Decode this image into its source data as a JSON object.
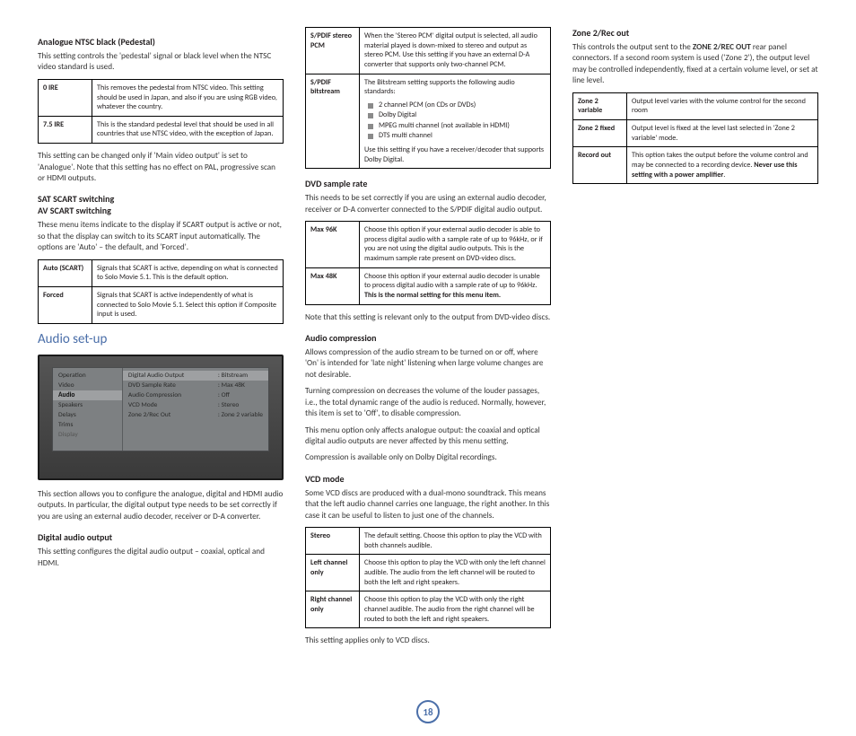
{
  "col1": {
    "h1": "Analogue NTSC black (Pedestal)",
    "p1": "This setting controls the 'pedestal' signal or black level when the NTSC video standard is used.",
    "t1r1l": "0 IRE",
    "t1r1v": "This removes the pedestal from NTSC video. This setting should be used in Japan, and also if you are using RGB video, whatever the country.",
    "t1r2l": "7.5 IRE",
    "t1r2v": "This is the standard pedestal level that should be used in all countries that use NTSC video, with the exception of Japan.",
    "p2": "This setting can be changed only if 'Main video output' is set to 'Analogue'. Note that this setting has no effect on PAL, progressive scan or HDMI outputs.",
    "h2": "SAT SCART switching\nAV SCART switching",
    "p3": "These menu items indicate to the display if SCART output is active or not, so that the display can switch to its SCART input automatically. The options are 'Auto' – the default, and 'Forced'.",
    "t2r1l": "Auto (SCART)",
    "t2r1v": "Signals that SCART is active, depending on what is connected to Solo Movie 5.1. This is the default option.",
    "t2r2l": "Forced",
    "t2r2v": "Signals that SCART is active independently of what is connected to Solo Movie 5.1. Select this option if Composite input is used."
  },
  "col2": {
    "title": "Audio set-up",
    "menu": {
      "left": [
        "Operation",
        "Video",
        "Audio",
        "Speakers",
        "Delays",
        "Trims",
        "Display"
      ],
      "right": [
        [
          "Digital Audio Output",
          ": Bitstream"
        ],
        [
          "DVD Sample Rate",
          ": Max 48K"
        ],
        [
          "Audio Compression",
          ": Off"
        ],
        [
          "VCD Mode",
          ": Stereo"
        ],
        [
          "Zone 2/Rec Out",
          ": Zone 2 variable"
        ]
      ]
    },
    "p1": "This section allows you to configure the analogue, digital and HDMI audio outputs. In particular, the digital output type needs to be set correctly if you are using an external audio decoder, receiver or D-A converter.",
    "h1": "Digital audio output",
    "p2": "This setting configures the digital audio output – coaxial, optical and HDMI.",
    "t1r1l": "S/PDIF stereo PCM",
    "t1r1v": "When the 'Stereo PCM' digital output is selected, all audio material played is down-mixed to stereo and output as stereo PCM. Use this setting if you have an external D-A converter that supports only two-channel PCM.",
    "t1r2l": "S/PDIF bitstream",
    "t1r2v_intro": "The Bitstream setting supports the following audio standards:",
    "t1r2_bullets": [
      "2 channel PCM (on CDs or DVDs)",
      "Dolby Digital",
      "MPEG multi channel (not available in HDMI)",
      "DTS multi channel"
    ],
    "t1r2v_out": "Use this setting if you have a receiver/decoder that supports Dolby Digital.",
    "h2": "DVD sample rate",
    "p3": "This needs to be set correctly if you are using an external audio decoder, receiver or D-A converter connected to the S/PDIF digital audio output.",
    "t2r1l": "Max 96K",
    "t2r1v": "Choose this option if your external audio decoder is able to process digital audio with a sample rate of up to 96kHz, or if you are not using the digital audio outputs. This is the maximum sample rate present on DVD-video discs.",
    "t2r2l": "Max 48K",
    "t2r2v_a": "Choose this option if your external audio decoder is unable to process digital audio with a sample rate of up to 96kHz. ",
    "t2r2v_b": "This is the normal setting for this menu item.",
    "p4": "Note that this setting is relevant only to the output from DVD-video discs."
  },
  "col3": {
    "h1": "Audio compression",
    "p1": "Allows compression of the audio stream to be turned on or off, where 'On' is intended for 'late night' listening when large volume changes are not desirable.",
    "p2": "Turning compression on decreases the volume of the louder passages, i.e., the total dynamic range of the audio is reduced. Normally, however, this item is set to 'Off', to disable compression.",
    "p3": "This menu option only affects analogue output: the coaxial and optical digital audio outputs are never affected by this menu setting.",
    "p4": "Compression is available only on Dolby Digital recordings.",
    "h2": "VCD mode",
    "p5": "Some VCD discs are produced with a dual-mono soundtrack. This means that the left audio channel carries one language, the right another. In this case it can be useful to listen to just one of the channels.",
    "t1r1l": "Stereo",
    "t1r1v": "The default setting. Choose this option to play the VCD with both channels audible.",
    "t1r2l": "Left channel only",
    "t1r2v": "Choose this option to play the VCD with only the left channel audible. The audio from the left channel will be routed to both the left and right speakers.",
    "t1r3l": "Right channel only",
    "t1r3v": "Choose this option to play the VCD with only the right channel audible. The audio from the right channel will be routed to both the left and right speakers.",
    "p6": "This setting applies only to VCD discs.",
    "h3": "Zone 2/Rec out",
    "p7a": "This controls the output sent to the ",
    "p7b": "ZONE 2/REC OUT",
    "p7c": " rear panel connectors. If a second room system is used ('Zone 2'), the output level may be controlled independently, fixed at a certain volume level, or set at line level.",
    "t2r1l": "Zone 2 variable",
    "t2r1v": "Output level varies with the volume control for the second room",
    "t2r2l": "Zone 2 fixed",
    "t2r2v": "Output level is fixed at the level last selected in 'Zone 2 variable' mode.",
    "t2r3l": "Record out",
    "t2r3v_a": "This option takes the output before the volume control and may be connected to a recording device. ",
    "t2r3v_b": "Never use this setting with a power amplifier",
    "t2r3v_c": "."
  },
  "page": "18"
}
